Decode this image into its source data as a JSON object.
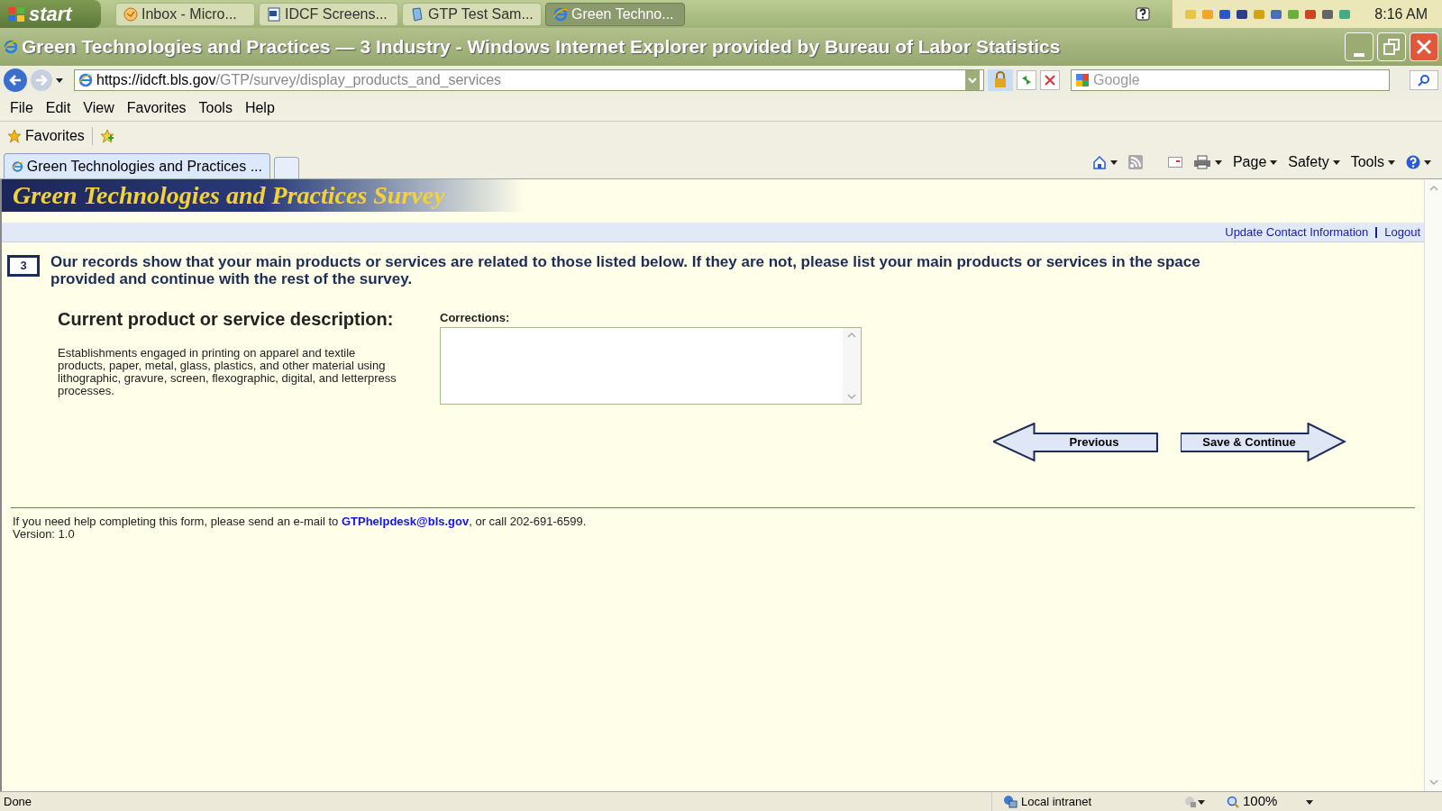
{
  "taskbar": {
    "start_label": "start",
    "tasks": [
      {
        "label": "Inbox - Micro...",
        "kind": "mail",
        "selected": false
      },
      {
        "label": "IDCF Screens...",
        "kind": "word",
        "selected": false
      },
      {
        "label": "GTP Test Sam...",
        "kind": "doc",
        "selected": false
      },
      {
        "label": "Green Techno...",
        "kind": "ie",
        "selected": true
      }
    ],
    "clock": "8:16 AM"
  },
  "window": {
    "title": "Green Technologies and Practices — 3 Industry - Windows Internet Explorer provided by Bureau of Labor Statistics"
  },
  "address_bar": {
    "url_host": "https://idcft.bls.gov",
    "url_path": "/GTP/survey/display_products_and_services",
    "search_placeholder": "Google"
  },
  "menu": [
    "File",
    "Edit",
    "View",
    "Favorites",
    "Tools",
    "Help"
  ],
  "favorites_label": "Favorites",
  "tabs": [
    {
      "label": "Green Technologies and Practices ...",
      "selected": true
    }
  ],
  "command_bar": [
    "Page",
    "Safety",
    "Tools"
  ],
  "page": {
    "banner_title": "Green Technologies and Practices Survey",
    "links": [
      "Update Contact Information",
      "Logout"
    ],
    "question_number": "3",
    "question": "Our records show that your main products or services are related to those listed below. If they are not, please list your main products or services in the space provided and continue with the rest of the survey.",
    "description_heading": "Current product or service description:",
    "description": "Establishments engaged in printing on apparel and textile products, paper, metal, glass, plastics, and other material using lithographic, gravure, screen, flexographic, digital, and letterpress processes.",
    "corrections_label": "Corrections:",
    "previous_button": "Previous",
    "next_button": "Save & Continue",
    "help_prefix": "If you need help completing this form, please send an e-mail to ",
    "help_email": "GTPhelpdesk@bls.gov",
    "help_suffix": ", or call 202-691-6599.",
    "version": "Version: 1.0"
  },
  "status_bar": {
    "status": "Done",
    "zone": "Local intranet",
    "zoom": "100%"
  }
}
